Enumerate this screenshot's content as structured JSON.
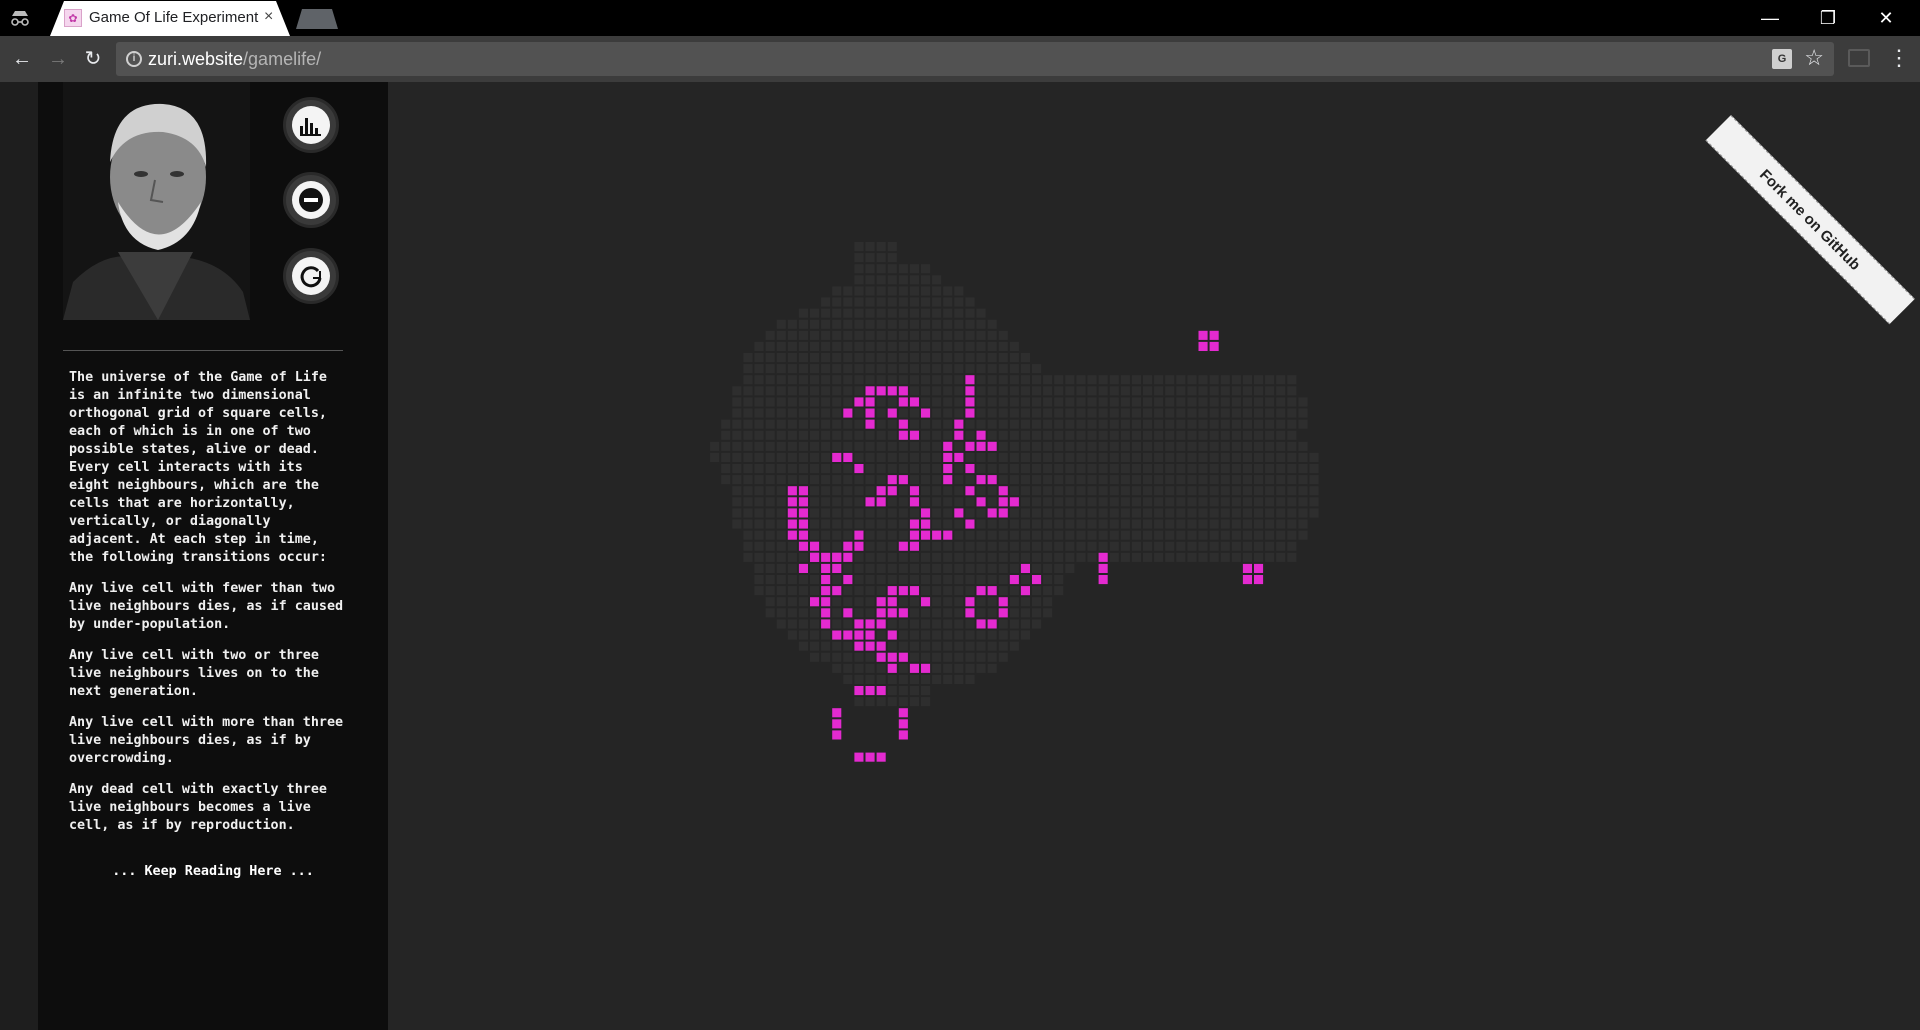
{
  "browser": {
    "tab_title": "Game Of Life Experiment",
    "tab_close": "×",
    "url_host": "zuri.website",
    "url_path": "/gamelife/",
    "minimize": "—",
    "restore": "❐",
    "close": "✕"
  },
  "sidebar": {
    "paragraphs": [
      "The universe of the Game of Life\nis an infinite two dimensional\northogonal grid of square cells,\neach of which is in one of two\npossible states, alive or dead.\nEvery cell interacts with its\neight neighbours, which are the\ncells that are horizontally,\nvertically, or diagonally\nadjacent. At each step in time,\nthe following transitions occur:",
      "Any live cell with fewer than two\nlive neighbours dies, as if caused\nby under-population.",
      "Any live cell with two or three\nlive neighbours lives on to the\nnext generation.",
      "Any live cell with more than three\nlive neighbours dies, as if by\novercrowding.",
      "Any dead cell with exactly three\nlive neighbours becomes a live\ncell, as if by reproduction."
    ],
    "keep_reading": "... Keep Reading Here ..."
  },
  "ribbon": {
    "label": "Fork me on GitHub"
  },
  "colors": {
    "live": "#e42ad0",
    "trail": "#2e2e2e",
    "background": "#252525"
  }
}
